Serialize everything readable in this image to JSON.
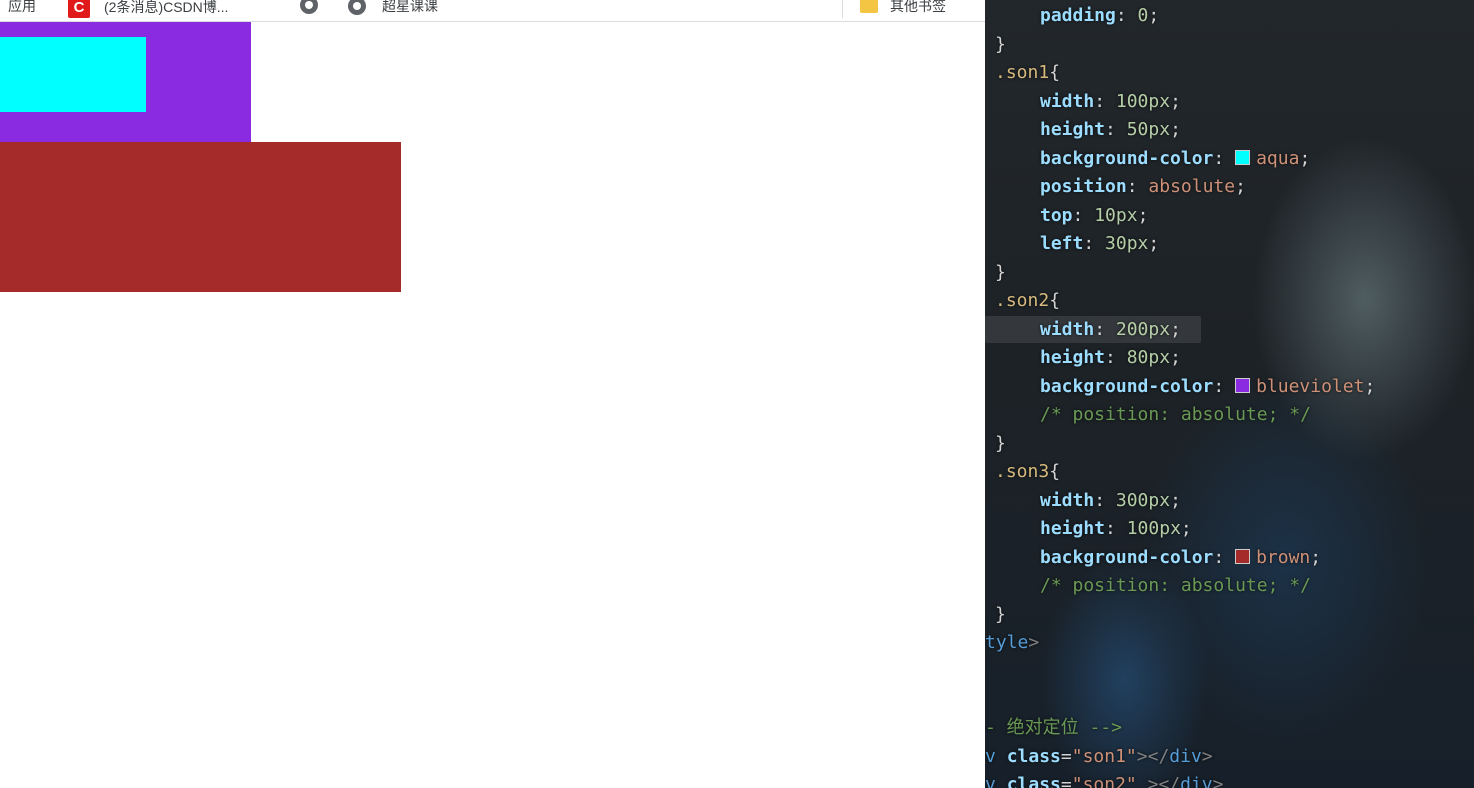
{
  "browser": {
    "bookmarks": {
      "apps_label": "应用",
      "csdn_logo": "C",
      "csdn_label": "(2条消息)CSDN博...",
      "globe2_label": "超星课课",
      "other_label": "其他书签"
    },
    "boxes": {
      "son1_color": "#00ffff",
      "son2_color": "#8a2be2",
      "son3_color": "#a52a2a"
    }
  },
  "editor": {
    "lines": [
      {
        "k": "padding",
        "v": "0"
      },
      {
        "t": "}"
      },
      {
        "sel": ".son1"
      },
      {
        "k": "width",
        "v": "100px"
      },
      {
        "k": "height",
        "v": "50px"
      },
      {
        "k": "background-color",
        "c": "aqua",
        "hex": "#00ffff"
      },
      {
        "k": "position",
        "kw": "absolute"
      },
      {
        "k": "top",
        "v": "10px"
      },
      {
        "k": "left",
        "v": "30px"
      },
      {
        "t": "}"
      },
      {
        "sel": ".son2"
      },
      {
        "k": "width",
        "v": "200px"
      },
      {
        "k": "height",
        "v": "80px"
      },
      {
        "k": "background-color",
        "c": "blueviolet",
        "hex": "#8a2be2"
      },
      {
        "cmt": "/* position: absolute; */"
      },
      {
        "t": "}"
      },
      {
        "sel": ".son3"
      },
      {
        "k": "width",
        "v": "300px"
      },
      {
        "k": "height",
        "v": "100px"
      },
      {
        "k": "background-color",
        "c": "brown",
        "hex": "#a52a2a"
      },
      {
        "cmt": "/* position: absolute; */"
      },
      {
        "t": "}"
      },
      {
        "close_tag": "tyle"
      },
      {
        "html_cmt": "- 绝对定位 -->"
      },
      {
        "div_open": "v",
        "attr": "class",
        "val": "son1"
      },
      {
        "div_open2": "v",
        "attr": "class",
        "val": "son2"
      }
    ]
  }
}
